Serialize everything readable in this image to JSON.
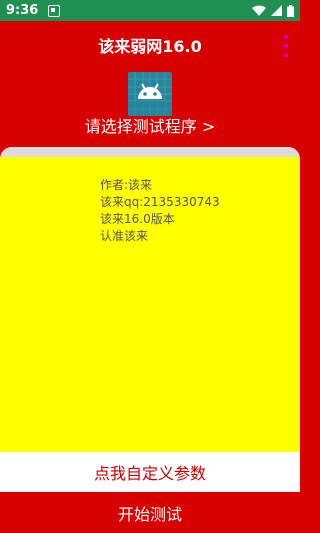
{
  "status_bar": {
    "time": "9:36",
    "icons": [
      "notification-icon",
      "wifi-icon",
      "cell-signal-icon",
      "battery-icon"
    ]
  },
  "app_bar": {
    "title": "该来弱网16.0",
    "menu_icon": "more-vert-icon"
  },
  "header": {
    "app_icon": "android-icon",
    "select_program_label": "请选择测试程序 >"
  },
  "info": {
    "lines": [
      "作者:该来",
      "该来qq:2135330743",
      "该来16.0版本",
      "认准该来"
    ]
  },
  "buttons": {
    "custom_params": "点我自定义参数",
    "start_test": "开始测试"
  },
  "colors": {
    "status_bar": "#1f8f52",
    "background": "#d80000",
    "card": "#ffff00",
    "menu_dots": "#d100d1",
    "icon_bg": "#27869c"
  }
}
